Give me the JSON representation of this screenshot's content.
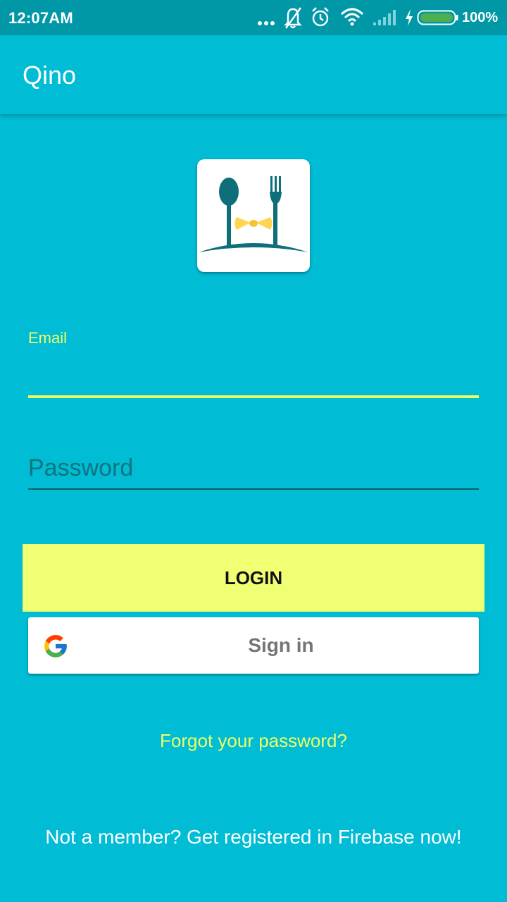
{
  "status_bar": {
    "time": "12:07AM",
    "battery_text": "100%",
    "icons": [
      "more-dots-icon",
      "notifications-off-icon",
      "alarm-icon",
      "wifi-icon",
      "signal-icon",
      "charging-icon",
      "battery-icon"
    ],
    "battery_level": 1.0
  },
  "app_bar": {
    "title": "Qino"
  },
  "logo": {
    "icon": "restaurant-logo-icon"
  },
  "form": {
    "email_label": "Email",
    "email_value": "",
    "password_placeholder": "Password",
    "password_value": ""
  },
  "buttons": {
    "login_label": "LOGIN",
    "google_label": "Sign in"
  },
  "links": {
    "forgot_password": "Forgot your password?",
    "register": "Not a member? Get registered in Firebase now!"
  },
  "colors": {
    "background": "#00bcd4",
    "status_bar": "#0097a7",
    "accent": "#eeff66",
    "login_button": "#f1ff73"
  }
}
